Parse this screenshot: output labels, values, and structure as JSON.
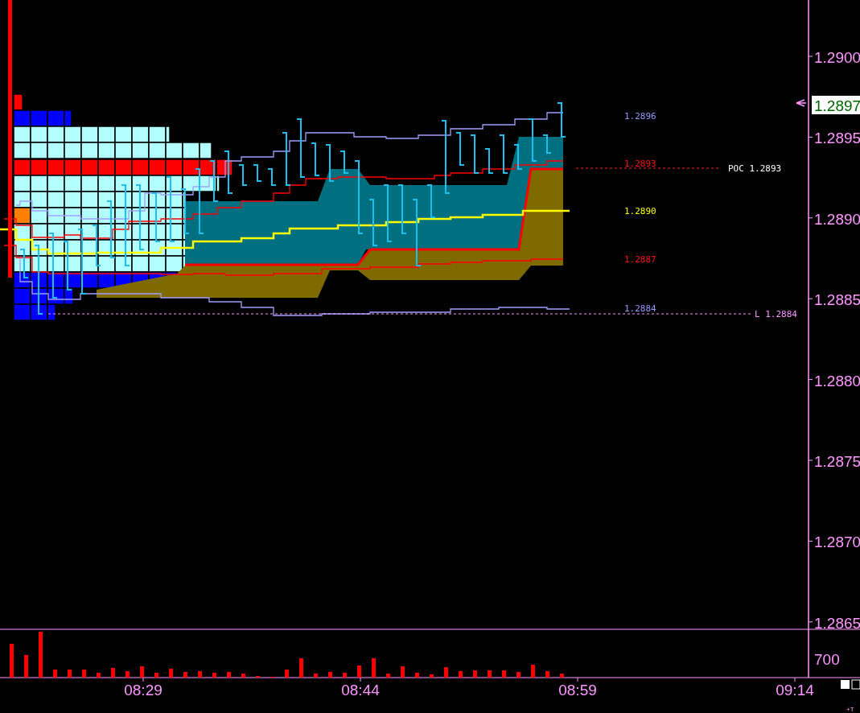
{
  "price_axis": {
    "ticks": [
      "1.2900",
      "1.2895",
      "1.2890",
      "1.2885",
      "1.2880",
      "1.2875",
      "1.2870",
      "1.2865"
    ],
    "last_price": "1.2897"
  },
  "levels": [
    {
      "text": "1.2896",
      "color": "#9a9aff"
    },
    {
      "text": "1.2893",
      "color": "#ff1010"
    },
    {
      "text": "1.2890",
      "color": "#ffff00"
    },
    {
      "text": "1.2887",
      "color": "#ff1010"
    },
    {
      "text": "1.2884",
      "color": "#9a9aff"
    }
  ],
  "poc_label": "POC 1.2893",
  "low_label": "L 1.2884",
  "volume_axis": {
    "ticks": [
      "700"
    ]
  },
  "time_axis": {
    "ticks": [
      "08:29",
      "08:44",
      "08:59",
      "09:14"
    ]
  },
  "corner_label": "+T"
}
